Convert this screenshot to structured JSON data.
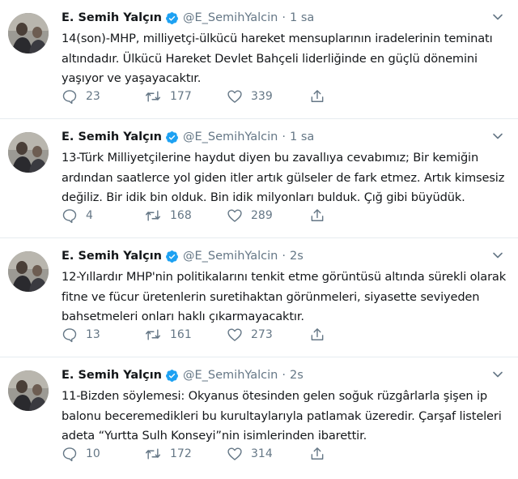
{
  "colors": {
    "text": "#14171a",
    "secondary": "#657786",
    "verified": "#1da1f2",
    "divider": "#e6ecf0"
  },
  "tweets": [
    {
      "name": "E. Semih Yalçın",
      "handle": "@E_SemihYalcin",
      "separator": "·",
      "time": "1 sa",
      "lines": [
        "14(son)-MHP, milliyetçi-ülkücü hareket mensuplarının iradelerinin teminatı",
        "altındadır. Ülkücü Hareket Devlet Bahçeli liderliğinde en güçlü dönemini",
        "yaşıyor ve yaşayacaktır."
      ],
      "replies": "23",
      "retweets": "177",
      "likes": "339"
    },
    {
      "name": "E. Semih Yalçın",
      "handle": "@E_SemihYalcin",
      "separator": "·",
      "time": "1 sa",
      "lines": [
        "13-Türk Milliyetçilerine haydut diyen bu zavallıya cevabımız; Bir kemiğin",
        "ardından saatlerce yol giden itler artık gülseler de fark etmez. Artık kimsesiz",
        "değiliz. Bir idik bin olduk. Bin idik milyonları bulduk. Çığ gibi büyüdük."
      ],
      "replies": "4",
      "retweets": "168",
      "likes": "289"
    },
    {
      "name": "E. Semih Yalçın",
      "handle": "@E_SemihYalcin",
      "separator": "·",
      "time": "2s",
      "lines": [
        "12-Yıllardır MHP'nin politikalarını tenkit etme görüntüsü altında sürekli olarak",
        "fitne ve fücur üretenlerin suretihaktan görünmeleri, siyasette seviyeden",
        "bahsetmeleri onları haklı çıkarmayacaktır."
      ],
      "replies": "13",
      "retweets": "161",
      "likes": "273"
    },
    {
      "name": "E. Semih Yalçın",
      "handle": "@E_SemihYalcin",
      "separator": "·",
      "time": "2s",
      "lines": [
        "11-Bizden söylemesi: Okyanus ötesinden gelen soğuk rüzgârlarla şişen ip",
        "balonu beceremedikleri bu kurultaylarıyla patlamak üzeredir. Çarşaf listeleri",
        "adeta “Yurtta Sulh Konseyi”nin isimlerinden ibarettir."
      ],
      "replies": "10",
      "retweets": "172",
      "likes": "314"
    }
  ]
}
